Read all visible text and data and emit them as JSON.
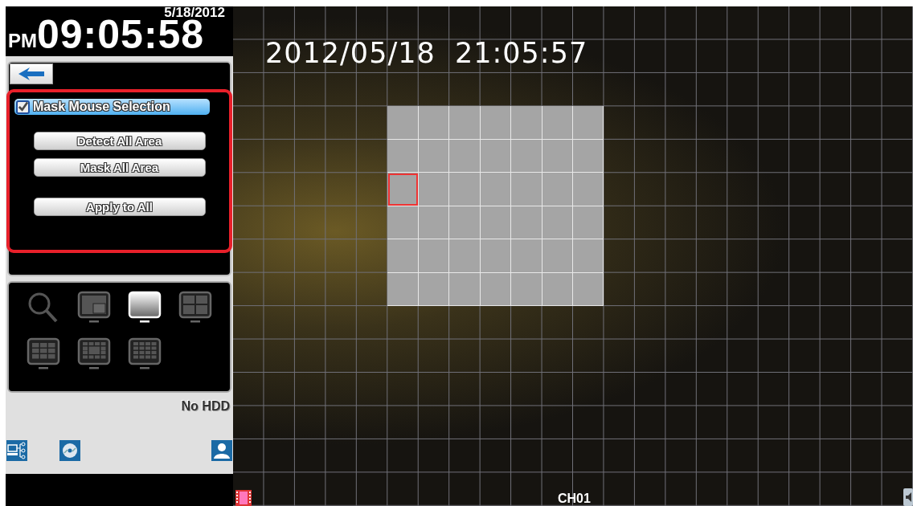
{
  "clock": {
    "date": "5/18/2012",
    "meridiem": "PM",
    "time": "09:05:58"
  },
  "mask_panel": {
    "mask_mouse_selection": {
      "label": "Mask Mouse Selection",
      "checked": true
    },
    "buttons": [
      "Detect All Area",
      "Mask All Area",
      "Apply to All"
    ]
  },
  "layouts": [
    {
      "kind": "search",
      "selected": false
    },
    {
      "kind": "pip",
      "selected": false
    },
    {
      "kind": "single",
      "selected": true
    },
    {
      "kind": "quad",
      "selected": false
    },
    {
      "kind": "nine",
      "selected": false
    },
    {
      "kind": "center",
      "selected": false
    },
    {
      "kind": "sixteen",
      "selected": false
    }
  ],
  "disk_status": "No HDD",
  "video": {
    "osd_timestamp": "2012/05/18  21:05:57",
    "channel": "CH01",
    "mask_grid": [
      {
        "masked": [
          false,
          false,
          false,
          false,
          false,
          false,
          false,
          false,
          false,
          false,
          false,
          false,
          false,
          false,
          false,
          false,
          false,
          false,
          false,
          false,
          false,
          false
        ],
        "selected": [
          false,
          false,
          false,
          false,
          false,
          false,
          false,
          false,
          false,
          false,
          false,
          false,
          false,
          false,
          false,
          false,
          false,
          false,
          false,
          false,
          false,
          false
        ]
      },
      {
        "masked": [
          false,
          false,
          false,
          false,
          false,
          false,
          false,
          false,
          false,
          false,
          false,
          false,
          false,
          false,
          false,
          false,
          false,
          false,
          false,
          false,
          false,
          false
        ],
        "selected": [
          false,
          false,
          false,
          false,
          false,
          false,
          false,
          false,
          false,
          false,
          false,
          false,
          false,
          false,
          false,
          false,
          false,
          false,
          false,
          false,
          false,
          false
        ]
      },
      {
        "masked": [
          false,
          false,
          false,
          false,
          false,
          false,
          false,
          false,
          false,
          false,
          false,
          false,
          false,
          false,
          false,
          false,
          false,
          false,
          false,
          false,
          false,
          false
        ],
        "selected": [
          false,
          false,
          false,
          false,
          false,
          false,
          false,
          false,
          false,
          false,
          false,
          false,
          false,
          false,
          false,
          false,
          false,
          false,
          false,
          false,
          false,
          false
        ]
      },
      {
        "masked": [
          false,
          false,
          false,
          false,
          false,
          true,
          true,
          true,
          true,
          true,
          true,
          true,
          false,
          false,
          false,
          false,
          false,
          false,
          false,
          false,
          false,
          false
        ],
        "selected": [
          false,
          false,
          false,
          false,
          false,
          false,
          false,
          false,
          false,
          false,
          false,
          false,
          false,
          false,
          false,
          false,
          false,
          false,
          false,
          false,
          false,
          false
        ]
      },
      {
        "masked": [
          false,
          false,
          false,
          false,
          false,
          true,
          true,
          true,
          true,
          true,
          true,
          true,
          false,
          false,
          false,
          false,
          false,
          false,
          false,
          false,
          false,
          false
        ],
        "selected": [
          false,
          false,
          false,
          false,
          false,
          false,
          false,
          false,
          false,
          false,
          false,
          false,
          false,
          false,
          false,
          false,
          false,
          false,
          false,
          false,
          false,
          false
        ]
      },
      {
        "masked": [
          false,
          false,
          false,
          false,
          false,
          true,
          true,
          true,
          true,
          true,
          true,
          true,
          false,
          false,
          false,
          false,
          false,
          false,
          false,
          false,
          false,
          false
        ],
        "selected": [
          false,
          false,
          false,
          false,
          false,
          true,
          false,
          false,
          false,
          false,
          false,
          false,
          false,
          false,
          false,
          false,
          false,
          false,
          false,
          false,
          false,
          false
        ]
      },
      {
        "masked": [
          false,
          false,
          false,
          false,
          false,
          true,
          true,
          true,
          true,
          true,
          true,
          true,
          false,
          false,
          false,
          false,
          false,
          false,
          false,
          false,
          false,
          false
        ],
        "selected": [
          false,
          false,
          false,
          false,
          false,
          false,
          false,
          false,
          false,
          false,
          false,
          false,
          false,
          false,
          false,
          false,
          false,
          false,
          false,
          false,
          false,
          false
        ]
      },
      {
        "masked": [
          false,
          false,
          false,
          false,
          false,
          true,
          true,
          true,
          true,
          true,
          true,
          true,
          false,
          false,
          false,
          false,
          false,
          false,
          false,
          false,
          false,
          false
        ],
        "selected": [
          false,
          false,
          false,
          false,
          false,
          false,
          false,
          false,
          false,
          false,
          false,
          false,
          false,
          false,
          false,
          false,
          false,
          false,
          false,
          false,
          false,
          false
        ]
      },
      {
        "masked": [
          false,
          false,
          false,
          false,
          false,
          true,
          true,
          true,
          true,
          true,
          true,
          true,
          false,
          false,
          false,
          false,
          false,
          false,
          false,
          false,
          false,
          false
        ],
        "selected": [
          false,
          false,
          false,
          false,
          false,
          false,
          false,
          false,
          false,
          false,
          false,
          false,
          false,
          false,
          false,
          false,
          false,
          false,
          false,
          false,
          false,
          false
        ]
      },
      {
        "masked": [
          false,
          false,
          false,
          false,
          false,
          false,
          false,
          false,
          false,
          false,
          false,
          false,
          false,
          false,
          false,
          false,
          false,
          false,
          false,
          false,
          false,
          false
        ],
        "selected": [
          false,
          false,
          false,
          false,
          false,
          false,
          false,
          false,
          false,
          false,
          false,
          false,
          false,
          false,
          false,
          false,
          false,
          false,
          false,
          false,
          false,
          false
        ]
      },
      {
        "masked": [
          false,
          false,
          false,
          false,
          false,
          false,
          false,
          false,
          false,
          false,
          false,
          false,
          false,
          false,
          false,
          false,
          false,
          false,
          false,
          false,
          false,
          false
        ],
        "selected": [
          false,
          false,
          false,
          false,
          false,
          false,
          false,
          false,
          false,
          false,
          false,
          false,
          false,
          false,
          false,
          false,
          false,
          false,
          false,
          false,
          false,
          false
        ]
      },
      {
        "masked": [
          false,
          false,
          false,
          false,
          false,
          false,
          false,
          false,
          false,
          false,
          false,
          false,
          false,
          false,
          false,
          false,
          false,
          false,
          false,
          false,
          false,
          false
        ],
        "selected": [
          false,
          false,
          false,
          false,
          false,
          false,
          false,
          false,
          false,
          false,
          false,
          false,
          false,
          false,
          false,
          false,
          false,
          false,
          false,
          false,
          false,
          false
        ]
      },
      {
        "masked": [
          false,
          false,
          false,
          false,
          false,
          false,
          false,
          false,
          false,
          false,
          false,
          false,
          false,
          false,
          false,
          false,
          false,
          false,
          false,
          false,
          false,
          false
        ],
        "selected": [
          false,
          false,
          false,
          false,
          false,
          false,
          false,
          false,
          false,
          false,
          false,
          false,
          false,
          false,
          false,
          false,
          false,
          false,
          false,
          false,
          false,
          false
        ]
      },
      {
        "masked": [
          false,
          false,
          false,
          false,
          false,
          false,
          false,
          false,
          false,
          false,
          false,
          false,
          false,
          false,
          false,
          false,
          false,
          false,
          false,
          false,
          false,
          false
        ],
        "selected": [
          false,
          false,
          false,
          false,
          false,
          false,
          false,
          false,
          false,
          false,
          false,
          false,
          false,
          false,
          false,
          false,
          false,
          false,
          false,
          false,
          false,
          false
        ]
      },
      {
        "masked": [
          false,
          false,
          false,
          false,
          false,
          false,
          false,
          false,
          false,
          false,
          false,
          false,
          false,
          false,
          false,
          false,
          false,
          false,
          false,
          false,
          false,
          false
        ],
        "selected": [
          false,
          false,
          false,
          false,
          false,
          false,
          false,
          false,
          false,
          false,
          false,
          false,
          false,
          false,
          false,
          false,
          false,
          false,
          false,
          false,
          false,
          false
        ]
      }
    ]
  }
}
